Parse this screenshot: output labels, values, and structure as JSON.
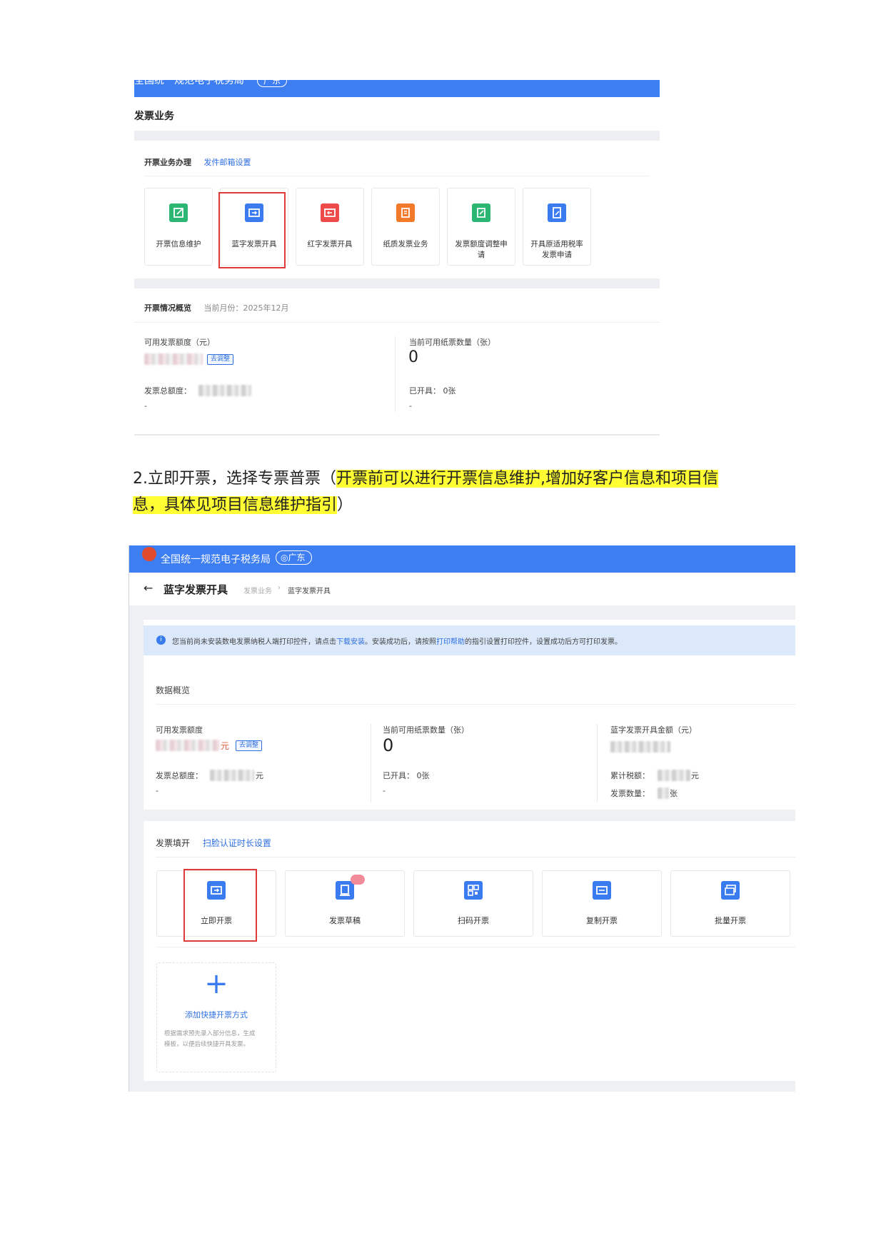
{
  "shot1": {
    "header_cut_text": "全国统一规范电子税务局",
    "header_region": "广东",
    "page_title": "发票业务",
    "business_section": {
      "title": "开票业务办理",
      "link": "发件邮箱设置"
    },
    "tiles": [
      {
        "label": "开票信息维护",
        "color": "#2bb673"
      },
      {
        "label": "蓝字发票开具",
        "color": "#3a7bf0"
      },
      {
        "label": "红字发票开具",
        "color": "#ee4a4a"
      },
      {
        "label": "纸质发票业务",
        "color": "#f27a2a"
      },
      {
        "label": "发票额度调整申请",
        "color": "#2bb673"
      },
      {
        "label": "开具原适用税率发票申请",
        "color": "#3a7bf0"
      }
    ],
    "overview": {
      "title": "开票情况概览",
      "month": "当前月份：2025年12月",
      "quota_label": "可用发票额度（元）",
      "adjust_btn": "去调整",
      "total_label": "发票总额度：",
      "dash1": "-",
      "paper_label": "当前可用纸票数量（张）",
      "paper_value": "0",
      "issued": "已开具：  0张",
      "dash2": "-"
    }
  },
  "paragraph": {
    "prefix": "2.立即开票，选择专票普票（",
    "highlight1": "开票前可以进行开票信息维护,增加好客户信息和项目信",
    "highlight2": "息，具体见项目信息维护指引",
    "suffix": "）"
  },
  "shot2": {
    "header_title": "全国统一规范电子税务局",
    "header_region": "广东",
    "back_title": "蓝字发票开具",
    "breadcrumb": [
      "发票业务",
      "蓝字发票开具"
    ],
    "notice": {
      "t1": "您当前尚未安装数电发票纳税人端打印控件，请点击",
      "link1": "下载安装",
      "t2": "。安装成功后，请按照",
      "link2": "打印帮助",
      "t3": "的指引设置打印控件，设置成功后方可打印发票。"
    },
    "data": {
      "title": "数据概览",
      "quota_label": "可用发票额度",
      "quota_unit": "元",
      "adjust_btn": "去调整",
      "total_label": "发票总额度：",
      "total_unit": "元",
      "dash1": "-",
      "paper_label": "当前可用纸票数量（张）",
      "paper_value": "0",
      "issued": "已开具：  0张",
      "dash2": "-",
      "blue_label": "蓝字发票开具金额（元）",
      "tax_label": "累计税额：",
      "tax_unit": "元",
      "count_label": "发票数量：",
      "count_unit": "张"
    },
    "fill": {
      "title": "发票填开",
      "link": "扫脸认证时长设置",
      "tiles": [
        "立即开票",
        "发票草稿",
        "扫码开票",
        "复制开票",
        "批量开票"
      ],
      "add_title": "添加快捷开票方式",
      "add_desc1": "根据需求预先录入部分信息，生成",
      "add_desc2": "模板，以便后续快捷开具发票。"
    }
  }
}
